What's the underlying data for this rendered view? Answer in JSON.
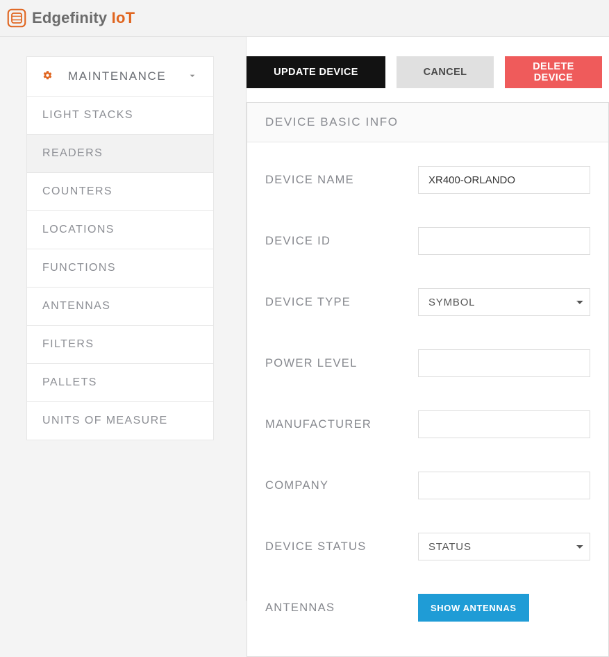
{
  "brand": {
    "part1": "Edgefinity ",
    "part2": "IoT"
  },
  "sidebar": {
    "header": "MAINTENANCE",
    "items": [
      {
        "label": "LIGHT STACKS",
        "active": false
      },
      {
        "label": "READERS",
        "active": true
      },
      {
        "label": "COUNTERS",
        "active": false
      },
      {
        "label": "LOCATIONS",
        "active": false
      },
      {
        "label": "FUNCTIONS",
        "active": false
      },
      {
        "label": "ANTENNAS",
        "active": false
      },
      {
        "label": "FILTERS",
        "active": false
      },
      {
        "label": "PALLETS",
        "active": false
      },
      {
        "label": "UNITS OF MEASURE",
        "active": false
      }
    ]
  },
  "actions": {
    "update": "UPDATE DEVICE",
    "cancel": "CANCEL",
    "delete": "DELETE DEVICE"
  },
  "panel": {
    "title": "DEVICE BASIC INFO",
    "labels": {
      "device_name": "DEVICE NAME",
      "device_id": "DEVICE ID",
      "device_type": "DEVICE TYPE",
      "power_level": "POWER LEVEL",
      "manufacturer": "MANUFACTURER",
      "company": "COMPANY",
      "device_status": "DEVICE STATUS",
      "antennas": "ANTENNAS"
    },
    "values": {
      "device_name": "XR400-ORLANDO",
      "device_id": "",
      "device_type": "SYMBOL",
      "power_level": "",
      "manufacturer": "",
      "company": "",
      "device_status": "STATUS"
    },
    "show_antennas": "SHOW ANTENNAS"
  }
}
